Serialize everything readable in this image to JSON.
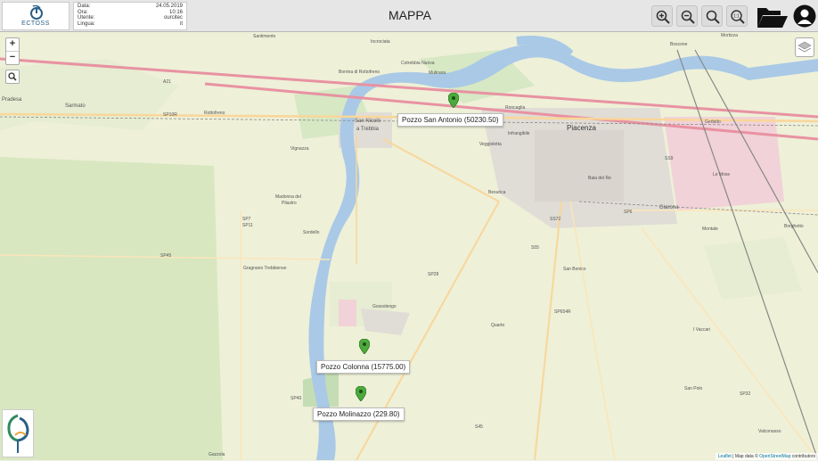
{
  "header": {
    "logo_text": "ECTOSS",
    "title": "MAPPA",
    "info": [
      {
        "label": "Data:",
        "value": "24.05.2019"
      },
      {
        "label": "Ora:",
        "value": "10:16"
      },
      {
        "label": "Utente:",
        "value": "ourcitec"
      },
      {
        "label": "Lingua:",
        "value": "it"
      }
    ]
  },
  "toolbar": {
    "zoom_in": "zoom-in-icon",
    "zoom_out": "zoom-out-icon",
    "zoom_reset": "zoom-reset-icon",
    "zoom_fit": "zoom-fit-icon",
    "folder": "folder-icon",
    "user": "user-icon",
    "zoom_fit_text": "1:1"
  },
  "map_controls": {
    "zoom_plus": "+",
    "zoom_minus": "−",
    "search_icon": "search-icon",
    "layers_icon": "layers-icon"
  },
  "markers": [
    {
      "label": "Pozzo San Antonio (50230.50)",
      "color": "#4caa3c"
    },
    {
      "label": "Pozzo Colonna (15775.00)",
      "color": "#4caa3c"
    },
    {
      "label": "Pozzo Molinazzo (229.80)",
      "color": "#4caa3c"
    }
  ],
  "map_labels": {
    "sarmato": "Sarmato",
    "pradesa": "Pradesa",
    "rottofreno": "Rottofreno",
    "san_nicolo": "San Nicolò",
    "a_trebbia": "a Trebbia",
    "vignazza": "Vignazza",
    "madonna": "Madonna del",
    "pilastro": "Pilastro",
    "sordello": "Sordello",
    "gragnano": "Gragnano Trebbiense",
    "gossolengo": "Gossolengo",
    "quarto": "Quarto",
    "piacenza": "Piacenza",
    "infrangibile": "Infrangibile",
    "veggioletta": "Veggioletta",
    "besurica": "Besurica",
    "baia_del_re": "Baia del Re",
    "san_bonico": "San Bonico",
    "giarona": "Giarona",
    "montale": "Montale",
    "borghetto": "Borghetto",
    "le_mose": "Le Mose",
    "gerbido": "Gerbido",
    "san_polo": "San Polo",
    "i_vaccari": "I Vaccari",
    "valconasso": "Valconasso",
    "gazzola": "Gazzola",
    "santimento": "Santimento",
    "incrociata": "Incrociata",
    "cotrebbia": "Cotrebbia Nuova",
    "mulinara": "Mulinara",
    "boscone": "Boscone",
    "mortizza": "Mortizza",
    "borrina": "Borrina di Rottofreno",
    "roncaglia": "Roncaglia",
    "a21": "A21",
    "sp10r": "SP10R",
    "sp7": "SP7",
    "sp11": "SP11",
    "sp28": "SP28",
    "sp40": "SP40",
    "sp45": "SP45",
    "s45": "S45",
    "s55": "S55",
    "sp654r": "SP654R",
    "sp32": "SP32",
    "sp6": "SP6",
    "ss72": "SS72",
    "ss9": "SS9"
  },
  "attribution": {
    "leaflet": "Leaflet",
    "sep": " | Map data © ",
    "osm": "OpenStreetMap",
    "rest": " contributors"
  },
  "colors": {
    "river": "#a9c9e6",
    "motorway": "#e892a2",
    "primary_road": "#f9d69a",
    "urban": "#e0dcd6",
    "farmland": "#eef0d8",
    "green": "#c8dfb0",
    "railway": "#888888"
  }
}
